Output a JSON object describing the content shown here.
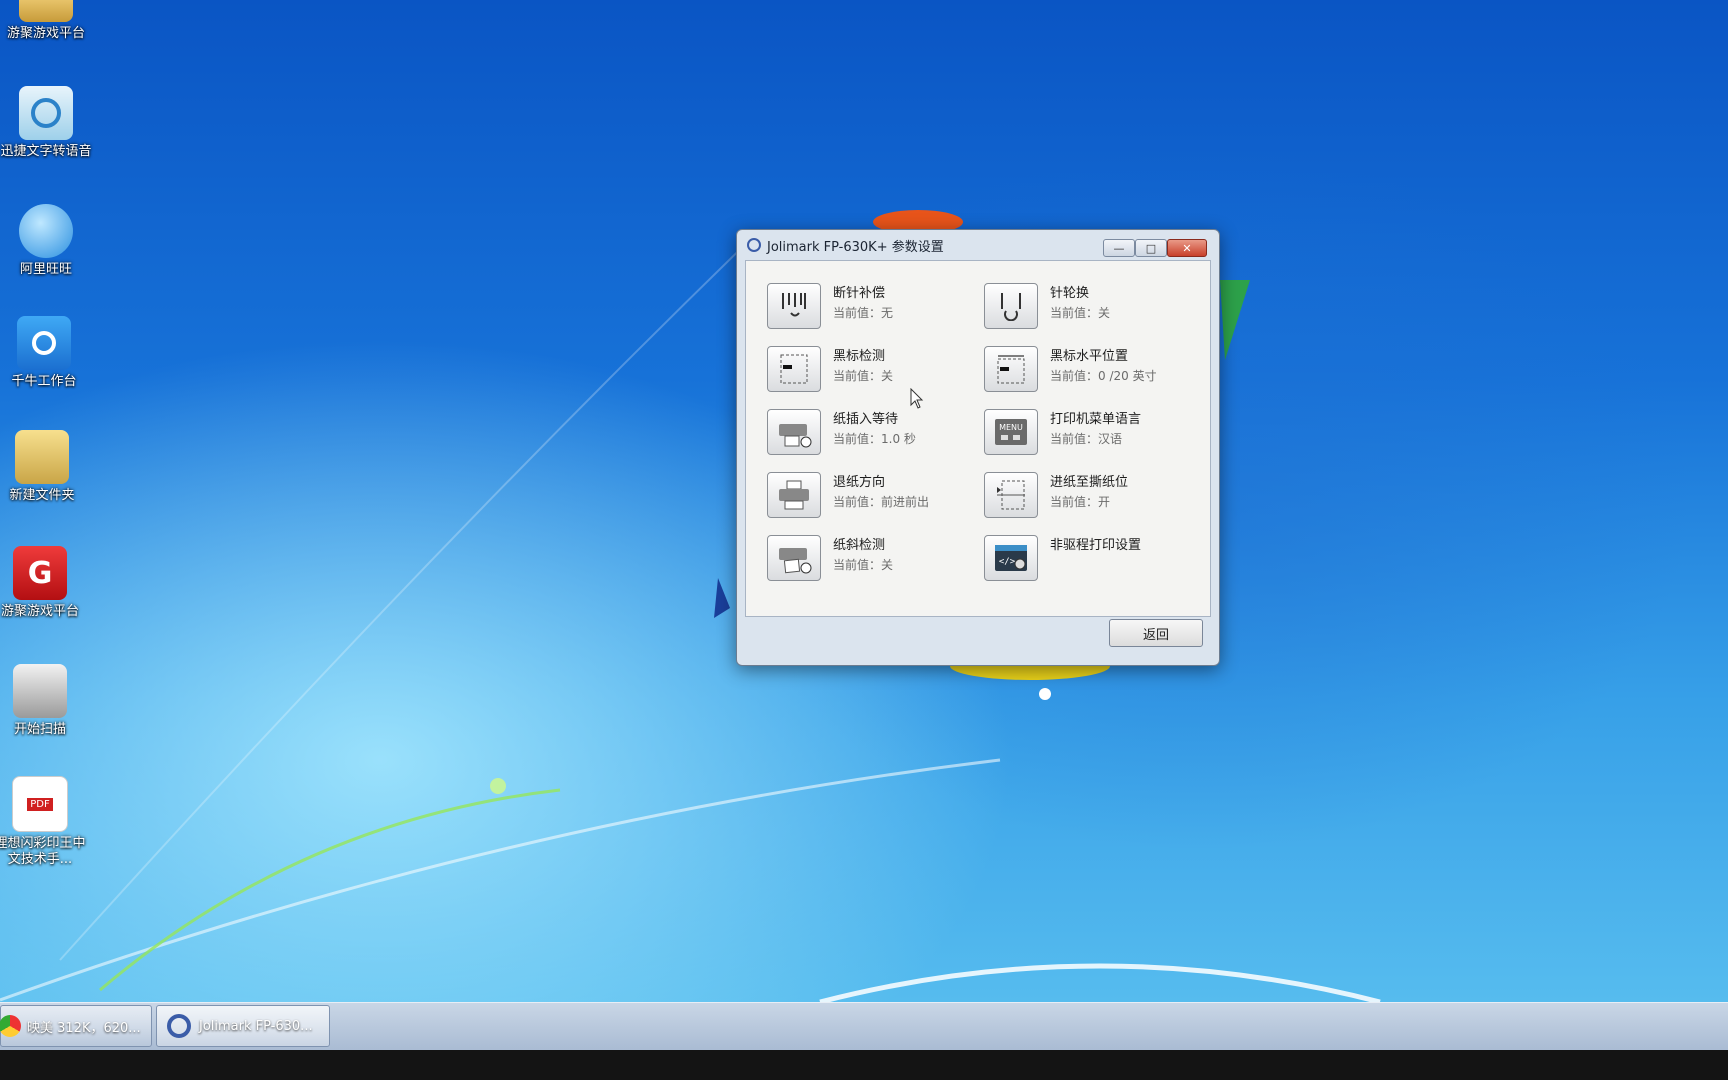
{
  "desktop": {
    "icons": [
      {
        "label": "游聚游戏平台",
        "icon": "folder-icon"
      },
      {
        "label": "迅捷文字转语音",
        "icon": "text-to-speech-icon"
      },
      {
        "label": "阿里旺旺",
        "icon": "aliwangwang-icon"
      },
      {
        "label": "千牛工作台",
        "icon": "qianniu-icon"
      },
      {
        "label": "新建文件夹",
        "icon": "folder-icon"
      },
      {
        "label": "游聚游戏平台",
        "icon": "game-platform-icon"
      },
      {
        "label": "开始扫描",
        "icon": "scanner-icon"
      },
      {
        "label": "理想闪彩印王中文技术手...",
        "icon": "pdf-icon"
      }
    ]
  },
  "dialog": {
    "title": "Jolimark FP-630K+ 参数设置",
    "controls": {
      "minimize": "—",
      "maximize": "□",
      "close": "✕"
    },
    "settings": [
      {
        "name": "断针补偿",
        "value": "当前值：无",
        "icon": "broken-needle-icon"
      },
      {
        "name": "针轮换",
        "value": "当前值：关",
        "icon": "needle-rotation-icon"
      },
      {
        "name": "黑标检测",
        "value": "当前值：关",
        "icon": "black-mark-detect-icon"
      },
      {
        "name": "黑标水平位置",
        "value": "当前值：0 /20 英寸",
        "icon": "black-mark-position-icon"
      },
      {
        "name": "纸插入等待",
        "value": "当前值：1.0 秒",
        "icon": "paper-insert-wait-icon"
      },
      {
        "name": "打印机菜单语言",
        "value": "当前值：汉语",
        "icon": "menu-language-icon"
      },
      {
        "name": "退纸方向",
        "value": "当前值：前进前出",
        "icon": "paper-eject-direction-icon"
      },
      {
        "name": "进纸至撕纸位",
        "value": "当前值：开",
        "icon": "feed-to-tear-icon"
      },
      {
        "name": "纸斜检测",
        "value": "当前值：关",
        "icon": "paper-skew-detect-icon"
      },
      {
        "name": "非驱程打印设置",
        "value": "",
        "icon": "non-driver-print-icon"
      }
    ],
    "back_label": "返回"
  },
  "taskbar": {
    "items": [
      {
        "label": "映美 312K，620...",
        "icon": "chrome-icon"
      },
      {
        "label": "Jolimark FP-630...",
        "icon": "printer-settings-icon"
      }
    ]
  }
}
